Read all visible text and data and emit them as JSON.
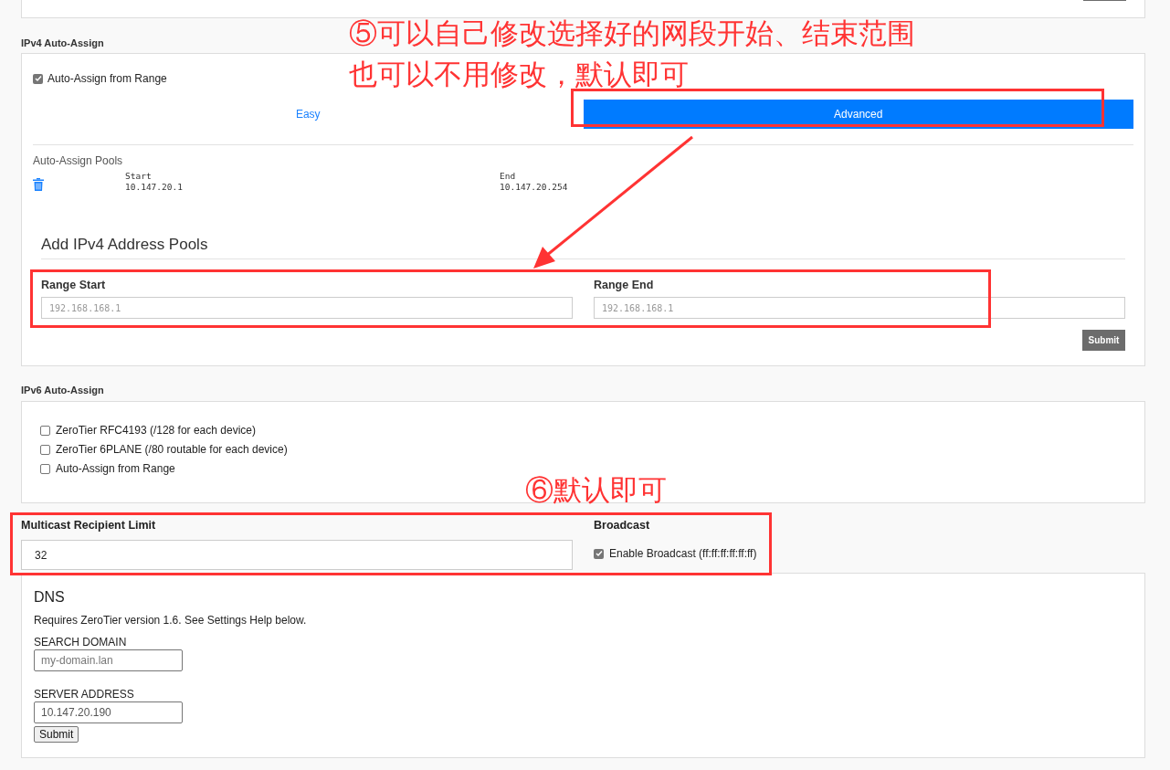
{
  "ipv4": {
    "heading": "IPv4 Auto-Assign",
    "auto_assign": {
      "label": "Auto-Assign from Range",
      "checked": true
    },
    "tabs": [
      {
        "label": "Easy",
        "selected": false
      },
      {
        "label": "Advanced",
        "selected": true
      }
    ],
    "pools_title": "Auto-Assign Pools",
    "pools": [
      {
        "start_label": "Start",
        "start": "10.147.20.1",
        "end_label": "End",
        "end": "10.147.20.254"
      }
    ],
    "add_title": "Add IPv4 Address Pools",
    "range_start": {
      "label": "Range Start",
      "placeholder": "192.168.168.1"
    },
    "range_end": {
      "label": "Range End",
      "placeholder": "192.168.168.1"
    },
    "submit": "Submit"
  },
  "ipv6": {
    "heading": "IPv6 Auto-Assign",
    "options": [
      {
        "label": "ZeroTier RFC4193 (/128 for each device)",
        "checked": false
      },
      {
        "label": "ZeroTier 6PLANE (/80 routable for each device)",
        "checked": false
      },
      {
        "label": "Auto-Assign from Range",
        "checked": false
      }
    ]
  },
  "multicast": {
    "label": "Multicast Recipient Limit",
    "value": "32"
  },
  "broadcast": {
    "label": "Broadcast",
    "option": "Enable Broadcast (ff:ff:ff:ff:ff:ff)",
    "checked": true
  },
  "dns": {
    "title": "DNS",
    "note": "Requires ZeroTier version 1.6. See Settings Help below.",
    "search_domain": {
      "label": "SEARCH DOMAIN",
      "placeholder": "my-domain.lan"
    },
    "server_address": {
      "label": "SERVER ADDRESS",
      "value": "10.147.20.190"
    },
    "submit": "Submit"
  },
  "annotations": [
    {
      "lines": [
        "⑤可以自己修改选择好的网段开始、结束范围",
        "也可以不用修改，默认即可"
      ]
    },
    {
      "lines": [
        "⑥默认即可"
      ]
    }
  ]
}
